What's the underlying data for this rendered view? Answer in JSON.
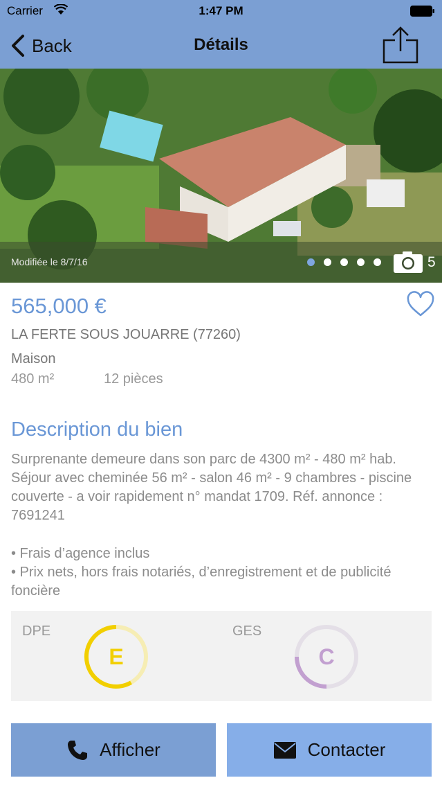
{
  "status_bar": {
    "carrier": "Carrier",
    "time": "1:47 PM"
  },
  "nav": {
    "back_label": "Back",
    "title": "Détails"
  },
  "photo": {
    "modified": "Modifiée le 8/7/16",
    "count": "5",
    "dots_total": 5,
    "active_dot": 0
  },
  "listing": {
    "price": "565,000 €",
    "location": "LA FERTE SOUS JOUARRE (77260)",
    "type": "Maison",
    "area": "480 m²",
    "rooms": "12 pièces"
  },
  "description": {
    "title": "Description du bien",
    "text": "Surprenante demeure dans son parc de 4300 m² - 480 m² hab. Séjour avec cheminée 56 m² - salon 46 m² - 9 chambres - piscine couverte - a voir rapidement n° mandat 1709. Réf. annonce : 7691241",
    "bullet1": "• Frais d’agence inclus",
    "bullet2": "• Prix nets, hors frais notariés, d’enregistrement et de publicité foncière"
  },
  "energy": {
    "dpe_label": "DPE",
    "dpe_class": "E",
    "dpe_color": "#f2cf00",
    "ges_label": "GES",
    "ges_class": "C",
    "ges_color": "#c2a0d0"
  },
  "footer": {
    "call_label": "Afficher",
    "contact_label": "Contacter"
  },
  "icons": [
    "wifi-icon",
    "battery-icon",
    "back-chevron-icon",
    "share-icon",
    "camera-icon",
    "heart-icon",
    "phone-icon",
    "mail-icon"
  ],
  "colors": {
    "nav": "#7b9fd3",
    "accent": "#6a97d6",
    "button_left": "#7b9fd3",
    "button_right": "#86aee8"
  }
}
